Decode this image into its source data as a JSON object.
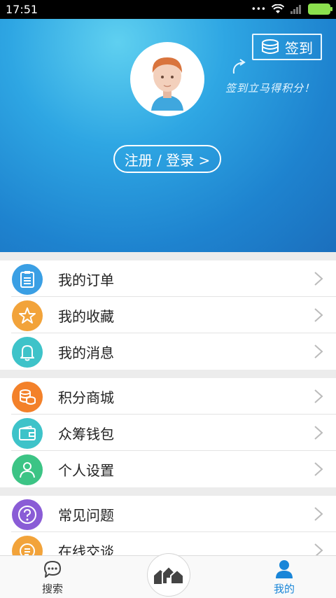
{
  "status_bar": {
    "time": "17:51",
    "dots": "•••"
  },
  "header": {
    "signin_label": "签到",
    "signin_hint": "签到立马得积分！",
    "login_label": "注册 / 登录 >"
  },
  "menu_groups": [
    [
      {
        "label": "我的订单",
        "icon": "clipboard-icon",
        "color": "#3a9fe4"
      },
      {
        "label": "我的收藏",
        "icon": "star-icon",
        "color": "#f2a33a"
      },
      {
        "label": "我的消息",
        "icon": "bell-icon",
        "color": "#3ec3c9"
      }
    ],
    [
      {
        "label": "积分商城",
        "icon": "coins-icon",
        "color": "#f3812a"
      },
      {
        "label": "众筹钱包",
        "icon": "wallet-icon",
        "color": "#3ec3c9"
      },
      {
        "label": "个人设置",
        "icon": "person-icon",
        "color": "#3cc485"
      }
    ],
    [
      {
        "label": "常见问题",
        "icon": "question-icon",
        "color": "#8a5cd6"
      },
      {
        "label": "在线交谈",
        "icon": "chat-list-icon",
        "color": "#f2a33a"
      }
    ]
  ],
  "tabbar": {
    "search_label": "搜索",
    "mine_label": "我的",
    "active_color": "#1a86d8"
  }
}
